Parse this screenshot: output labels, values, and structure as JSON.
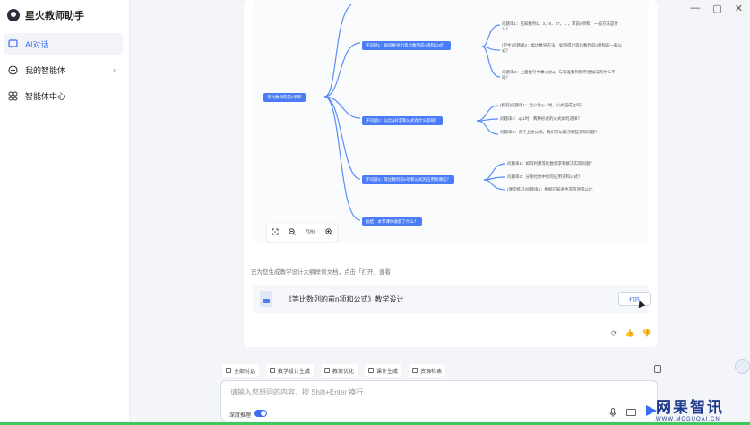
{
  "app": {
    "name": "星火教师助手"
  },
  "window_controls": [
    "—",
    "▢",
    "✕"
  ],
  "sidebar": {
    "items": [
      {
        "label": "AI对话",
        "icon": "chat-icon",
        "active": true
      },
      {
        "label": "我的智能体",
        "icon": "plus-circle-icon",
        "chevron": "›"
      },
      {
        "label": "智能体中心",
        "icon": "grid-icon"
      }
    ]
  },
  "mindmap": {
    "root": "等比数列的前n项和",
    "branches": [
      "子问题1：如何推导出等比数列前n项和公式？",
      "子问题2：公比q对求和公式有什么影响？",
      "子问题3：等比数列前n项和公式的应用有哪些？",
      "总结：本节课你收获了什么？"
    ],
    "leaves": [
      "问题串1：已知数列1，3，9，27，…，求前n项和，一般方法是什么？",
      "(学生)问题串2：类比推导方法，如何得出等比数列前n项和的一般公式？",
      "问题串3：上面推导中乘公比q，与等差数列倒序相加法有什么不同？",
      "(探究)问题串1：当公比q=1时，公式还成立吗？",
      "问题串2：q≠1时，两种形式的公式如何选择？",
      "问题串3：有了上述公式，我们可以解决哪些实际问题？",
      "问题串1：如何利用等比数列求和解决实际问题？",
      "问题串2：分期付款中如何应用求和公式？",
      "(课堂练习)问题串3：根据已知条件求首项或公比"
    ],
    "zoom": "70%"
  },
  "notice": "已为您生成教学设计大纲样例文档，点击「打开」查看：",
  "file": {
    "name": "《等比数列的前n项和公式》教学设计",
    "open_label": "打开"
  },
  "feedback": {
    "refresh": "⟳",
    "like": "👍",
    "dislike": "👎"
  },
  "toolbar": [
    {
      "label": "全部对话"
    },
    {
      "label": "教学设计生成"
    },
    {
      "label": "教案优化"
    },
    {
      "label": "课件生成"
    },
    {
      "label": "资源检索"
    }
  ],
  "input": {
    "placeholder": "请输入您想问的内容，按 Shift+Enter 换行",
    "deep_think_label": "深度推理",
    "deep_think_on": true
  },
  "watermark": {
    "main": "网果智讯",
    "sub": "WWW.MOGUOAI.CN"
  }
}
